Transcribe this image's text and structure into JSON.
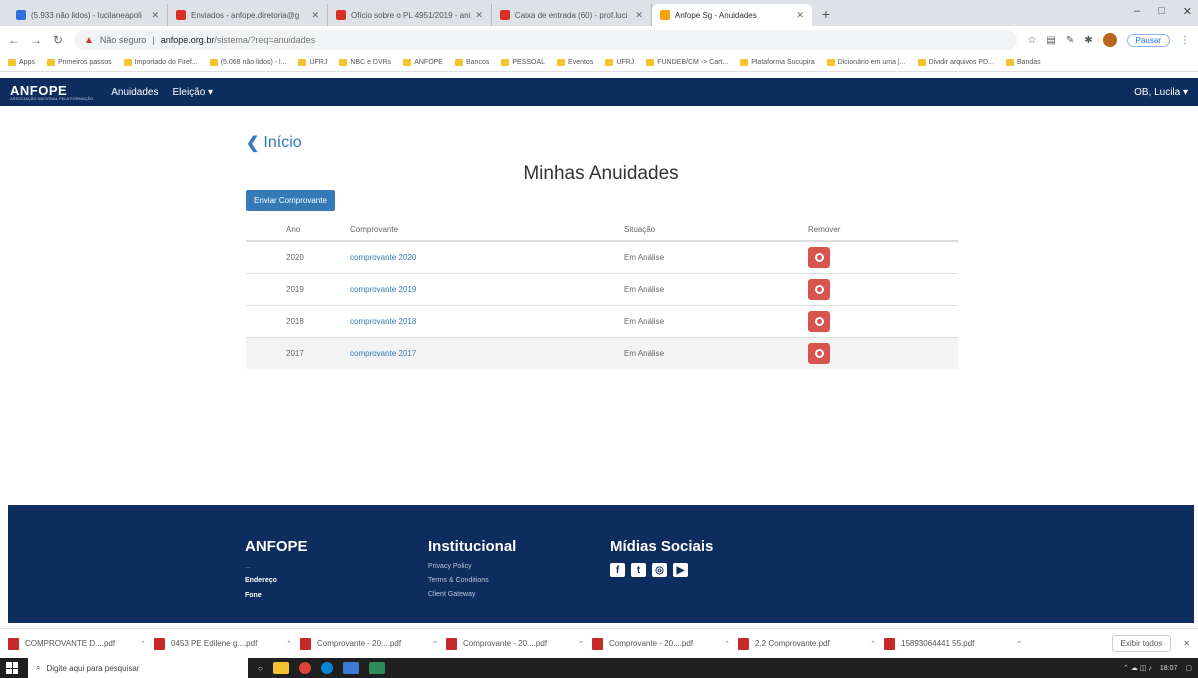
{
  "browser": {
    "tabs": [
      {
        "title": "(5.933 não lidos) - lucilaneapoli",
        "favcolor": "#2f6fe0"
      },
      {
        "title": "Enviados - anfope.diretoria@g",
        "favcolor": "#d93025"
      },
      {
        "title": "Ofício sobre o PL 4951/2019 - ani",
        "favcolor": "#d93025"
      },
      {
        "title": "Caixa de entrada (60) - prof.luci",
        "favcolor": "#d93025"
      },
      {
        "title": "Anfope Sg - Anuidades",
        "favcolor": "#f4a300"
      }
    ],
    "new_tab": "+",
    "window_controls": [
      "–",
      "□",
      "✕"
    ],
    "address": {
      "security": "Não seguro",
      "host": "anfope.org.br",
      "path": "/sistema/?req=anuidades"
    },
    "pause_label": "Pausar",
    "bookmarks": [
      "Apps",
      "Primeiros passos",
      "Importado do Firef...",
      "(5.068 não lidos) - l...",
      "UFRJ",
      "NBC e DVRs",
      "ANFOPE",
      "Bancos",
      "PESSOAL",
      "Eventos",
      "UFRJ",
      "FUNDEB/CM -> Cart...",
      "Plataforma Sucupira",
      "Dicionário em uma |...",
      "Dividir arquivos PD...",
      "Bandas"
    ]
  },
  "site": {
    "logo": "ANFOPE",
    "logo_tagline": "ASSOCIAÇÃO NACIONAL PELA FORMAÇÃO",
    "nav": [
      "Anuidades",
      "Eleição ▾"
    ],
    "user": "OB, Lucila ▾"
  },
  "main": {
    "back_label": "Início",
    "title": "Minhas Anuidades",
    "upload_button": "Enviar Comprovante",
    "columns": [
      "Ano",
      "Comprovante",
      "Situação",
      "Remover"
    ],
    "rows": [
      {
        "ano": "2020",
        "comprovante": "comprovante 2020",
        "situacao": "Em Análise"
      },
      {
        "ano": "2019",
        "comprovante": "comprovante 2019",
        "situacao": "Em Análise"
      },
      {
        "ano": "2018",
        "comprovante": "comprovante 2018",
        "situacao": "Em Análise"
      },
      {
        "ano": "2017",
        "comprovante": "comprovante 2017",
        "situacao": "Em Análise"
      }
    ]
  },
  "footer": {
    "col1": {
      "title": "ANFOPE",
      "items": [
        "...",
        "Endereço",
        "Fone"
      ]
    },
    "col2": {
      "title": "Institucional",
      "items": [
        "Privacy Policy",
        "Terms & Conditions",
        "Client Gateway"
      ]
    },
    "col3": {
      "title": "Mídias Sociais",
      "icons": [
        "facebook-icon",
        "twitter-icon",
        "instagram-icon",
        "youtube-icon"
      ]
    }
  },
  "downloads": {
    "items": [
      "COMPROVANTE D....pdf",
      "0453 PE Edilene g....pdf",
      "Comprovante - 20....pdf",
      "Comprovante - 20....pdf",
      "Comprovante - 20....pdf",
      "2.2 Comprovante.pdf",
      "15893064441 55.pdf"
    ],
    "show_all": "Exibir todos"
  },
  "taskbar": {
    "search_placeholder": "Digite aqui para pesquisar",
    "time": "18:07"
  }
}
